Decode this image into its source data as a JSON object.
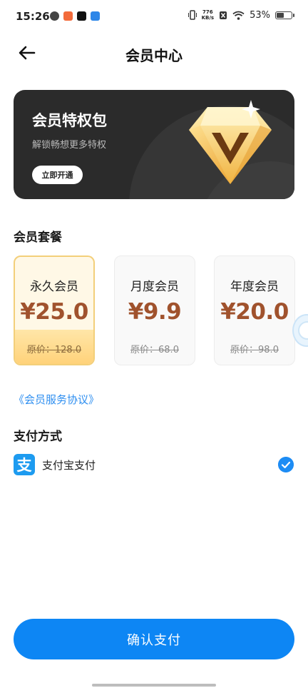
{
  "status_bar": {
    "time": "15:26",
    "net_speed_value": "776",
    "net_speed_unit": "KB/s",
    "battery": "53%",
    "battery_level": 0.53
  },
  "header": {
    "title": "会员中心"
  },
  "banner": {
    "title": "会员特权包",
    "subtitle": "解锁畅想更多特权",
    "button": "立即开通"
  },
  "plans": {
    "section_title": "会员套餐",
    "items": [
      {
        "name": "永久会员",
        "price": "¥25.0",
        "original": "原价：128.0",
        "selected": true
      },
      {
        "name": "月度会员",
        "price": "¥9.9",
        "original": "原价：68.0",
        "selected": false
      },
      {
        "name": "年度会员",
        "price": "¥20.0",
        "original": "原价：98.0",
        "selected": false
      }
    ]
  },
  "agreement": "《会员服务协议》",
  "payment": {
    "section_title": "支付方式",
    "icon_glyph": "支",
    "method": "支付宝支付",
    "checked": true
  },
  "confirm_button": "确认支付",
  "colors": {
    "accent_blue": "#0d86f4",
    "price_brown": "#a0522d",
    "selected_card_border": "#f3cf7a",
    "banner_bg": "#2b2b2b"
  }
}
